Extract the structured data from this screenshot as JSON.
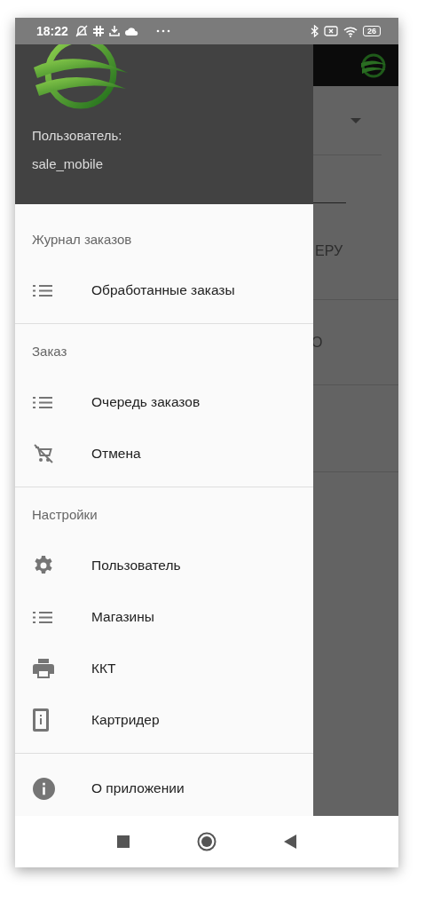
{
  "status_bar": {
    "time": "18:22",
    "battery": "26"
  },
  "drawer": {
    "header": {
      "user_label": "Пользователь:",
      "user_name": "sale_mobile"
    },
    "sections": [
      {
        "title": "Журнал заказов",
        "items": [
          {
            "label": "Обработанные заказы",
            "kind": "list"
          }
        ]
      },
      {
        "title": "Заказ",
        "items": [
          {
            "label": "Очередь заказов",
            "kind": "list"
          },
          {
            "label": "Отмена",
            "kind": "cancel"
          }
        ]
      },
      {
        "title": "Настройки",
        "items": [
          {
            "label": "Пользователь",
            "kind": "settings"
          },
          {
            "label": "Магазины",
            "kind": "list"
          },
          {
            "label": "ККТ",
            "kind": "printer"
          },
          {
            "label": "Картридер",
            "kind": "reader"
          }
        ]
      },
      {
        "items": [
          {
            "label": "О приложении",
            "kind": "info"
          }
        ]
      }
    ]
  },
  "background": {
    "fragments": [
      "ЕРУ",
      "О"
    ]
  }
}
